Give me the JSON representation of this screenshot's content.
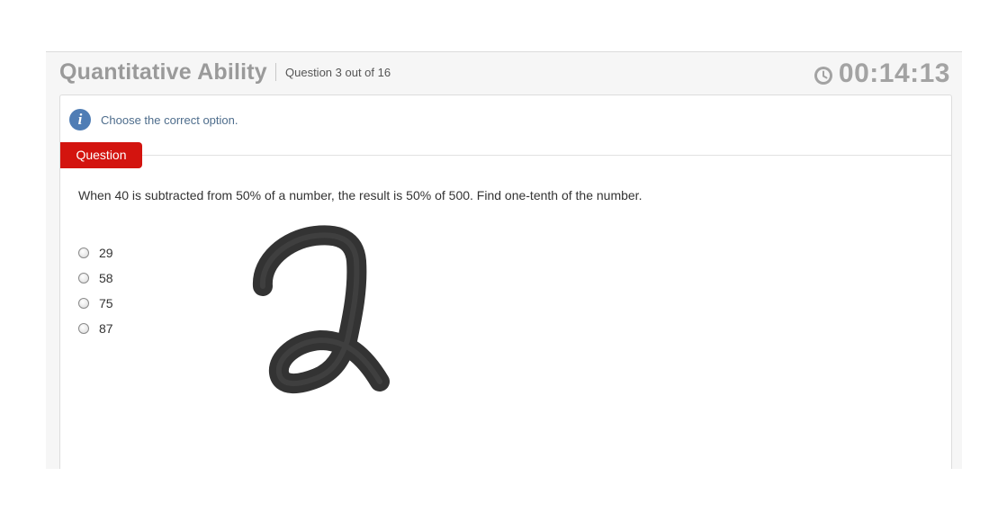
{
  "header": {
    "section_title": "Quantitative Ability",
    "question_count": "Question 3 out of 16",
    "timer": "00:14:13"
  },
  "info": {
    "text": "Choose the correct option.",
    "icon_glyph": "i",
    "icon_name": "info-icon"
  },
  "question": {
    "tab_label": "Question",
    "text": "When 40 is subtracted from 50% of a number, the result is 50% of 500. Find one-tenth of the number.",
    "options": [
      {
        "label": "29",
        "selected": false
      },
      {
        "label": "58",
        "selected": false
      },
      {
        "label": "75",
        "selected": false
      },
      {
        "label": "87",
        "selected": false
      }
    ]
  },
  "colors": {
    "accent_red": "#d3140f",
    "info_blue": "#4f7db5",
    "title_gray": "#9a9a9a",
    "timer_gray": "#a3a3a3"
  }
}
